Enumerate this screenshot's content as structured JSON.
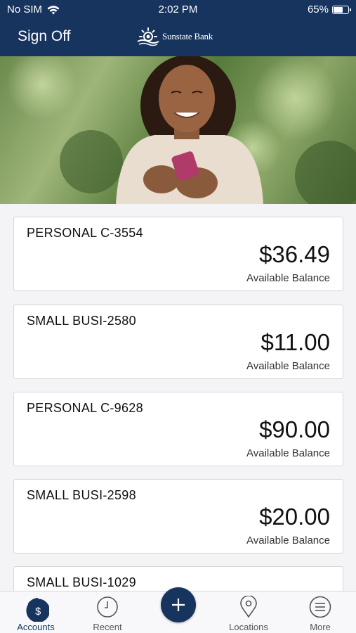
{
  "status_bar": {
    "carrier": "No SIM",
    "time": "2:02 PM",
    "battery": "65%",
    "battery_level": 0.65
  },
  "nav": {
    "sign_off": "Sign Off",
    "logo_text": "Sunstate Bank"
  },
  "accounts": [
    {
      "name": "PERSONAL C-3554",
      "amount": "$36.49",
      "label": "Available Balance"
    },
    {
      "name": "SMALL BUSI-2580",
      "amount": "$11.00",
      "label": "Available Balance"
    },
    {
      "name": "PERSONAL C-9628",
      "amount": "$90.00",
      "label": "Available Balance"
    },
    {
      "name": "SMALL BUSI-2598",
      "amount": "$20.00",
      "label": "Available Balance"
    },
    {
      "name": "SMALL BUSI-1029",
      "amount": "",
      "label": ""
    }
  ],
  "tabbar": {
    "accounts": "Accounts",
    "recent": "Recent",
    "locations": "Locations",
    "more": "More",
    "add_icon": "plus-icon"
  },
  "colors": {
    "brand": "#17345f",
    "background": "#f4f4f6",
    "card": "#ffffff"
  }
}
